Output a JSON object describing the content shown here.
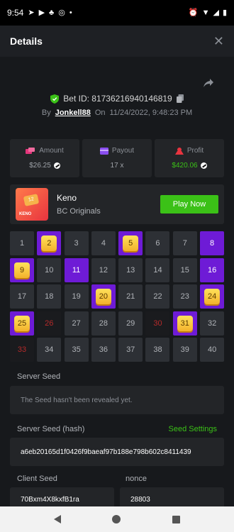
{
  "status": {
    "time": "9:54"
  },
  "header": {
    "title": "Details",
    "close_icon": "close-icon"
  },
  "bet": {
    "id_label": "Bet ID: 81736216940146819",
    "by_label": "By",
    "username": "Jonkell88",
    "on_label": "On",
    "datetime": "11/24/2022, 9:48:23 PM"
  },
  "stats": {
    "amount_label": "Amount",
    "amount_value": "$26.25",
    "payout_label": "Payout",
    "payout_value": "17 x",
    "profit_label": "Profit",
    "profit_value": "$420.06",
    "profit_color": "#3bc117"
  },
  "game": {
    "name": "Keno",
    "provider": "BC Originals",
    "play_label": "Play Now",
    "thumb_text": "KENO",
    "thumb_tile": "12"
  },
  "keno": {
    "cells": [
      {
        "n": "1",
        "s": "normal"
      },
      {
        "n": "2",
        "s": "hit"
      },
      {
        "n": "3",
        "s": "normal"
      },
      {
        "n": "4",
        "s": "normal"
      },
      {
        "n": "5",
        "s": "hit"
      },
      {
        "n": "6",
        "s": "normal"
      },
      {
        "n": "7",
        "s": "normal"
      },
      {
        "n": "8",
        "s": "purple"
      },
      {
        "n": "9",
        "s": "hit"
      },
      {
        "n": "10",
        "s": "normal"
      },
      {
        "n": "11",
        "s": "purple"
      },
      {
        "n": "12",
        "s": "normal"
      },
      {
        "n": "13",
        "s": "normal"
      },
      {
        "n": "14",
        "s": "normal"
      },
      {
        "n": "15",
        "s": "normal"
      },
      {
        "n": "16",
        "s": "purple"
      },
      {
        "n": "17",
        "s": "normal"
      },
      {
        "n": "18",
        "s": "normal"
      },
      {
        "n": "19",
        "s": "normal"
      },
      {
        "n": "20",
        "s": "hit"
      },
      {
        "n": "21",
        "s": "normal"
      },
      {
        "n": "22",
        "s": "normal"
      },
      {
        "n": "23",
        "s": "normal"
      },
      {
        "n": "24",
        "s": "hit"
      },
      {
        "n": "25",
        "s": "hit"
      },
      {
        "n": "26",
        "s": "dark"
      },
      {
        "n": "27",
        "s": "normal"
      },
      {
        "n": "28",
        "s": "normal"
      },
      {
        "n": "29",
        "s": "normal"
      },
      {
        "n": "30",
        "s": "dark"
      },
      {
        "n": "31",
        "s": "hit"
      },
      {
        "n": "32",
        "s": "normal"
      },
      {
        "n": "33",
        "s": "dark"
      },
      {
        "n": "34",
        "s": "normal"
      },
      {
        "n": "35",
        "s": "normal"
      },
      {
        "n": "36",
        "s": "normal"
      },
      {
        "n": "37",
        "s": "normal"
      },
      {
        "n": "38",
        "s": "normal"
      },
      {
        "n": "39",
        "s": "normal"
      },
      {
        "n": "40",
        "s": "normal"
      }
    ]
  },
  "seeds": {
    "server_seed_label": "Server Seed",
    "server_seed_value": "The Seed hasn't been revealed yet.",
    "server_hash_label": "Server Seed (hash)",
    "seed_settings_label": "Seed Settings",
    "server_hash_value": "a6eb20165d1f0426f9baeaf97b188e798b602c8411439",
    "client_seed_label": "Client Seed",
    "client_seed_value": "70Bxm4X8kxfB1ra",
    "nonce_label": "nonce",
    "nonce_value": "28803"
  },
  "colors": {
    "accent": "#3bc117",
    "purple": "#6e1bd6",
    "gold": "#f3b12c"
  }
}
